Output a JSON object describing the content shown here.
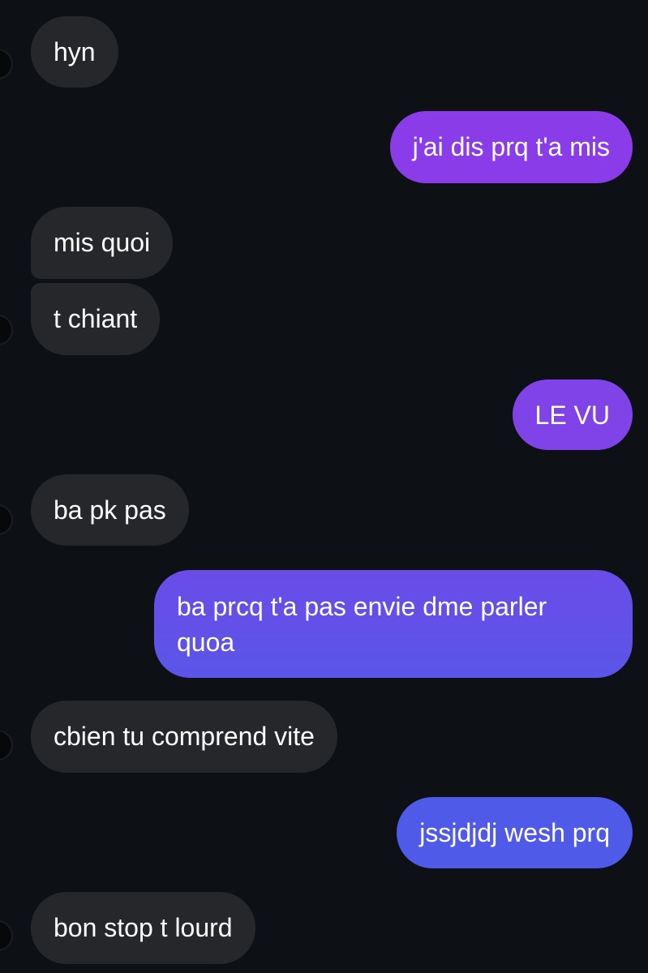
{
  "conversation": {
    "messages": [
      {
        "sender": "them",
        "text": "hyn"
      },
      {
        "sender": "me",
        "text": "j'ai dis prq t'a mis"
      },
      {
        "sender": "them",
        "text": "mis quoi"
      },
      {
        "sender": "them",
        "text": "t chiant"
      },
      {
        "sender": "me",
        "text": "LE VU"
      },
      {
        "sender": "them",
        "text": "ba pk pas"
      },
      {
        "sender": "me",
        "text": "ba prcq t'a pas envie dme parler\nquoa"
      },
      {
        "sender": "them",
        "text": "cbien tu comprend vite"
      },
      {
        "sender": "me",
        "text": "jssjdjdj wesh prq"
      },
      {
        "sender": "them",
        "text": "bon stop t lourd"
      }
    ]
  },
  "colors": {
    "background": "#0d1014",
    "incoming_bubble": "#25272b",
    "outgoing_top": "#8a3ce8",
    "outgoing_mid": "#6a4ce8",
    "outgoing_bottom": "#4f5ae8",
    "text": "#ffffff"
  }
}
